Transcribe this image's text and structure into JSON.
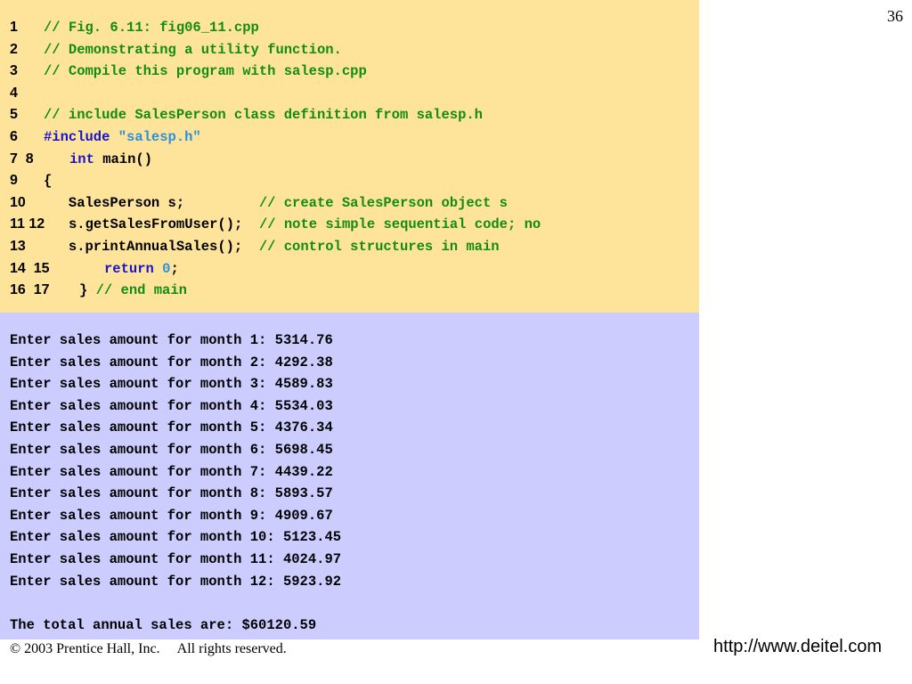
{
  "page_number": "36",
  "footer": {
    "copyright": "© 2003 Prentice Hall, Inc.     All rights reserved.",
    "website": "http://www.deitel.com"
  },
  "code": {
    "lines": [
      {
        "num": "1",
        "segments": [
          {
            "t": "// Fig. 6.11: fig06_11.cpp",
            "c": "comment"
          }
        ]
      },
      {
        "num": "2",
        "segments": [
          {
            "t": "// Demonstrating a utility function.",
            "c": "comment"
          }
        ]
      },
      {
        "num": "3",
        "segments": [
          {
            "t": "// Compile this program with salesp.cpp",
            "c": "comment"
          }
        ]
      },
      {
        "num": "4",
        "segments": []
      },
      {
        "num": "5",
        "segments": [
          {
            "t": "// include SalesPerson class definition from salesp.h",
            "c": "comment"
          }
        ]
      },
      {
        "num": "6",
        "segments": [
          {
            "t": "#include ",
            "c": "kw"
          },
          {
            "t": "\"salesp.h\"",
            "c": "str"
          }
        ]
      },
      {
        "num": "7  8",
        "segments": [
          {
            "t": "int",
            "c": "kw"
          },
          {
            "t": " main()",
            "c": "plain"
          }
        ]
      },
      {
        "num": "9",
        "segments": [
          {
            "t": "{",
            "c": "plain"
          }
        ]
      },
      {
        "num": "10",
        "segments": [
          {
            "t": "   SalesPerson s;         ",
            "c": "plain"
          },
          {
            "t": "// create SalesPerson object s",
            "c": "comment"
          }
        ]
      },
      {
        "num": "11 12",
        "segments": [
          {
            "t": "s.getSalesFromUser();  ",
            "c": "plain"
          },
          {
            "t": "// note simple sequential code; no",
            "c": "comment"
          }
        ]
      },
      {
        "num": "13",
        "segments": [
          {
            "t": "   s.printAnnualSales();  ",
            "c": "plain"
          },
          {
            "t": "// control structures in main",
            "c": "comment"
          }
        ]
      },
      {
        "num": "14  15",
        "segments": [
          {
            "t": "return ",
            "c": "kw"
          },
          {
            "t": "0",
            "c": "num"
          },
          {
            "t": ";",
            "c": "plain"
          }
        ]
      },
      {
        "num": "16  17",
        "segments": [
          {
            "t": "} ",
            "c": "plain"
          },
          {
            "t": "// end main",
            "c": "comment"
          }
        ]
      }
    ]
  },
  "output": {
    "lines": [
      "Enter sales amount for month 1: 5314.76",
      "Enter sales amount for month 2: 4292.38",
      "Enter sales amount for month 3: 4589.83",
      "Enter sales amount for month 4: 5534.03",
      "Enter sales amount for month 5: 4376.34",
      "Enter sales amount for month 6: 5698.45",
      "Enter sales amount for month 7: 4439.22",
      "Enter sales amount for month 8: 5893.57",
      "Enter sales amount for month 9: 4909.67",
      "Enter sales amount for month 10: 5123.45",
      "Enter sales amount for month 11: 4024.97",
      "Enter sales amount for month 12: 5923.92",
      "",
      "The total annual sales are: $60120.59"
    ]
  }
}
